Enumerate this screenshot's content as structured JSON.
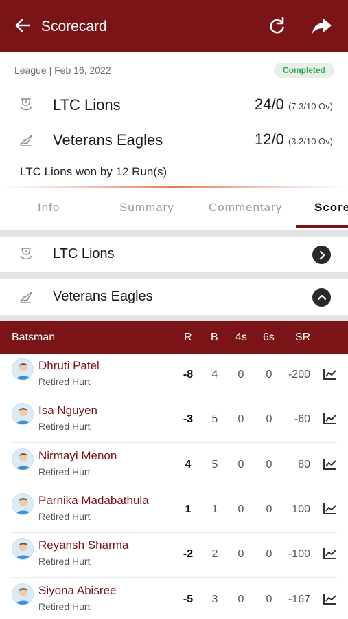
{
  "appbar": {
    "title": "Scorecard",
    "back_icon": "arrow-left-icon",
    "refresh_icon": "refresh-icon",
    "share_icon": "share-icon",
    "color": "#7b1416"
  },
  "match": {
    "meta": "League | Feb 16, 2022",
    "status": "Completed",
    "teams": [
      {
        "name": "LTC Lions",
        "score": "24/0",
        "overs": "(7.3/10 Ov)"
      },
      {
        "name": "Veterans Eagles",
        "score": "12/0",
        "overs": "(3.2/10 Ov)"
      }
    ],
    "result": "LTC Lions won by 12 Run(s)"
  },
  "tabs": [
    {
      "label": "Info",
      "active": false
    },
    {
      "label": "Summary",
      "active": false
    },
    {
      "label": "Commentary",
      "active": false
    },
    {
      "label": "Score",
      "active": true
    }
  ],
  "innings": [
    {
      "team": "LTC Lions",
      "state": "collapsed",
      "toggle_icon": "chevron-right-icon"
    },
    {
      "team": "Veterans Eagles",
      "state": "expanded",
      "toggle_icon": "chevron-up-icon"
    }
  ],
  "batting": {
    "headers": {
      "batsman": "Batsman",
      "runs": "R",
      "balls": "B",
      "fours": "4s",
      "sixes": "6s",
      "strike_rate": "SR"
    },
    "rows": [
      {
        "name": "Dhruti Patel",
        "dismissal": "Retired Hurt",
        "runs": "-8",
        "balls": "4",
        "fours": "0",
        "sixes": "0",
        "sr": "-200"
      },
      {
        "name": "Isa Nguyen",
        "dismissal": "Retired Hurt",
        "runs": "-3",
        "balls": "5",
        "fours": "0",
        "sixes": "0",
        "sr": "-60"
      },
      {
        "name": "Nirmayi Menon",
        "dismissal": "Retired Hurt",
        "runs": "4",
        "balls": "5",
        "fours": "0",
        "sixes": "0",
        "sr": "80"
      },
      {
        "name": "Parnika Madabathula",
        "dismissal": "Retired Hurt",
        "runs": "1",
        "balls": "1",
        "fours": "0",
        "sixes": "0",
        "sr": "100"
      },
      {
        "name": "Reyansh Sharma",
        "dismissal": "Retired Hurt",
        "runs": "-2",
        "balls": "2",
        "fours": "0",
        "sixes": "0",
        "sr": "-100"
      },
      {
        "name": "Siyona Abisree",
        "dismissal": "Retired Hurt",
        "runs": "-5",
        "balls": "3",
        "fours": "0",
        "sixes": "0",
        "sr": "-167"
      }
    ]
  }
}
